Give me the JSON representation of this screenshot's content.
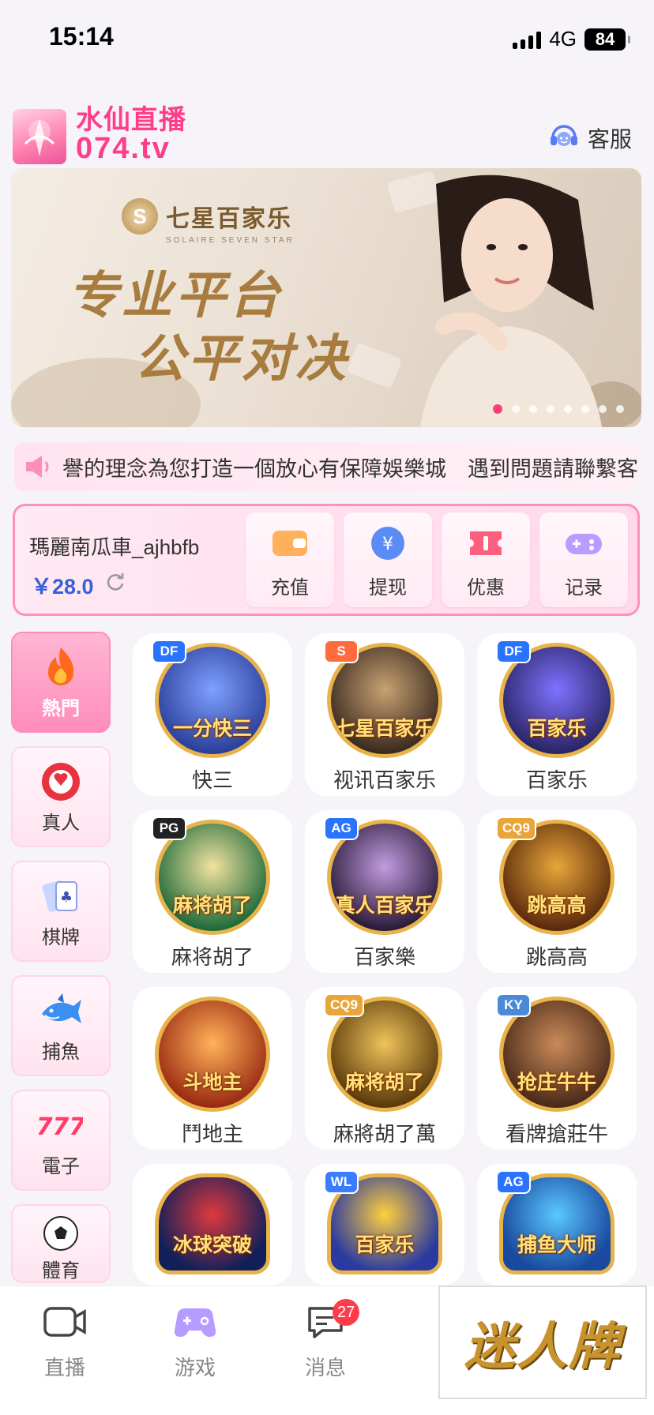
{
  "status_bar": {
    "time": "15:14",
    "network": "4G",
    "battery": "84"
  },
  "header": {
    "logo_line1": "水仙直播",
    "logo_line2": "074.tv",
    "service_label": "客服"
  },
  "banner": {
    "brand": "七星百家乐",
    "brand_sub": "SOLAIRE SEVEN STAR",
    "line1": "专业平台",
    "line2": "公平对决",
    "slide_count": 8,
    "active_slide": 1
  },
  "marquee": {
    "text": "譽的理念為您打造一個放心有保障娛樂城　遇到問題請聯繫客"
  },
  "wallet": {
    "username": "瑪麗南瓜車_ajhbfb",
    "balance": "￥28.0",
    "actions": [
      {
        "label": "充值",
        "icon": "wallet-icon"
      },
      {
        "label": "提现",
        "icon": "yen-coin-icon"
      },
      {
        "label": "优惠",
        "icon": "ticket-icon"
      },
      {
        "label": "记录",
        "icon": "gamepad-icon"
      }
    ]
  },
  "categories": [
    {
      "label": "熱門",
      "icon": "fire-icon",
      "active": true
    },
    {
      "label": "真人",
      "icon": "poker-chip-icon",
      "active": false
    },
    {
      "label": "棋牌",
      "icon": "cards-icon",
      "active": false
    },
    {
      "label": "捕魚",
      "icon": "shark-icon",
      "active": false
    },
    {
      "label": "電子",
      "icon": "slot-777-icon",
      "active": false
    },
    {
      "label": "體育",
      "icon": "soccer-ball-icon",
      "active": false
    }
  ],
  "games": [
    {
      "label": "快三",
      "badge": "DF",
      "art": "一分快三"
    },
    {
      "label": "视讯百家乐",
      "badge": "S",
      "art": "七星百家乐"
    },
    {
      "label": "百家乐",
      "badge": "DF",
      "art": "百家乐"
    },
    {
      "label": "麻将胡了",
      "badge": "PG",
      "art": "麻将胡了"
    },
    {
      "label": "百家樂",
      "badge": "AG",
      "art": "真人百家乐"
    },
    {
      "label": "跳高高",
      "badge": "CQ9",
      "art": "跳高高"
    },
    {
      "label": "鬥地主",
      "badge": "",
      "art": "斗地主"
    },
    {
      "label": "麻將胡了萬",
      "badge": "CQ9",
      "art": "麻将胡了"
    },
    {
      "label": "看牌搶莊牛",
      "badge": "KY",
      "art": "抢庄牛牛"
    },
    {
      "label": "",
      "badge": "",
      "art": "冰球突破"
    },
    {
      "label": "",
      "badge": "WL",
      "art": "百家乐"
    },
    {
      "label": "",
      "badge": "AG",
      "art": "捕鱼大师"
    }
  ],
  "bottom_nav": [
    {
      "label": "直播",
      "icon": "video-camera-icon"
    },
    {
      "label": "游戏",
      "icon": "gamepad-icon"
    },
    {
      "label": "消息",
      "icon": "message-icon",
      "badge": "27"
    }
  ],
  "corner_ad": {
    "text": "迷人牌"
  },
  "colors": {
    "accent": "#ff3d8b",
    "balance": "#3a5fd9",
    "badge_red": "#ff3b4a"
  }
}
